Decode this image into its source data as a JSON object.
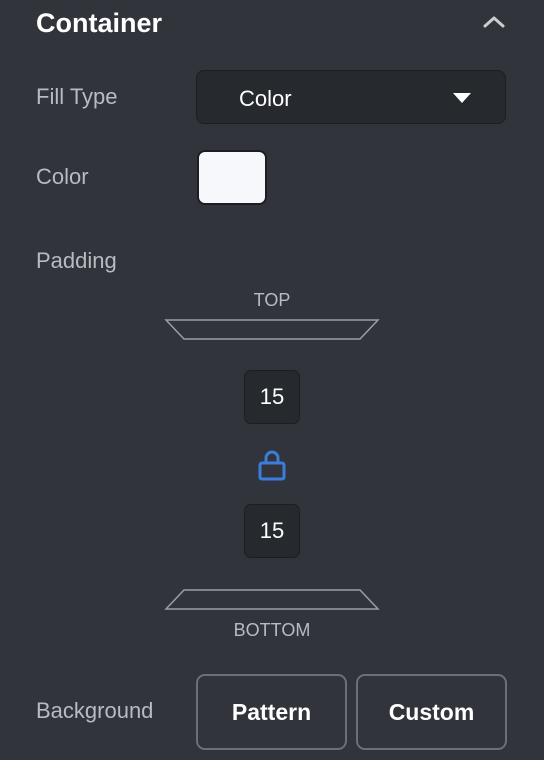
{
  "section": {
    "title": "Container",
    "collapse_icon": "chevron-up-icon"
  },
  "fill_type": {
    "label": "Fill Type",
    "value": "Color",
    "icon": "caret-down-icon"
  },
  "color": {
    "label": "Color",
    "swatch": "#f6f8fc"
  },
  "padding": {
    "label": "Padding",
    "top_label": "TOP",
    "bottom_label": "BOTTOM",
    "top_value": "15",
    "bottom_value": "15",
    "lock_icon": "lock-icon",
    "lock_color": "#3b7ddd"
  },
  "background": {
    "label": "Background",
    "buttons": [
      "Pattern",
      "Custom"
    ]
  }
}
